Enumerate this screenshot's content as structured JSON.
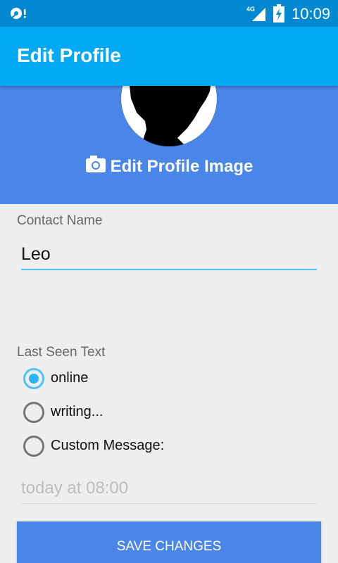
{
  "status_bar": {
    "time": "10:09",
    "network": "4G",
    "icons": [
      "notification-icon",
      "signal-icon",
      "battery-charging-icon"
    ]
  },
  "app_bar": {
    "title": "Edit Profile",
    "color": "#03a9f4"
  },
  "profile": {
    "edit_image_label": "Edit Profile Image",
    "camera_icon": "camera-icon",
    "header_color": "#4a86e8"
  },
  "contact": {
    "label": "Contact Name",
    "value": "Leo"
  },
  "last_seen": {
    "label": "Last Seen Text",
    "options": [
      {
        "label": "online",
        "selected": true
      },
      {
        "label": "writing...",
        "selected": false
      },
      {
        "label": "Custom Message:",
        "selected": false
      }
    ],
    "custom_placeholder": "today at 08:00"
  },
  "actions": {
    "save_label": "SAVE CHANGES",
    "accent": "#4fc3f7"
  }
}
